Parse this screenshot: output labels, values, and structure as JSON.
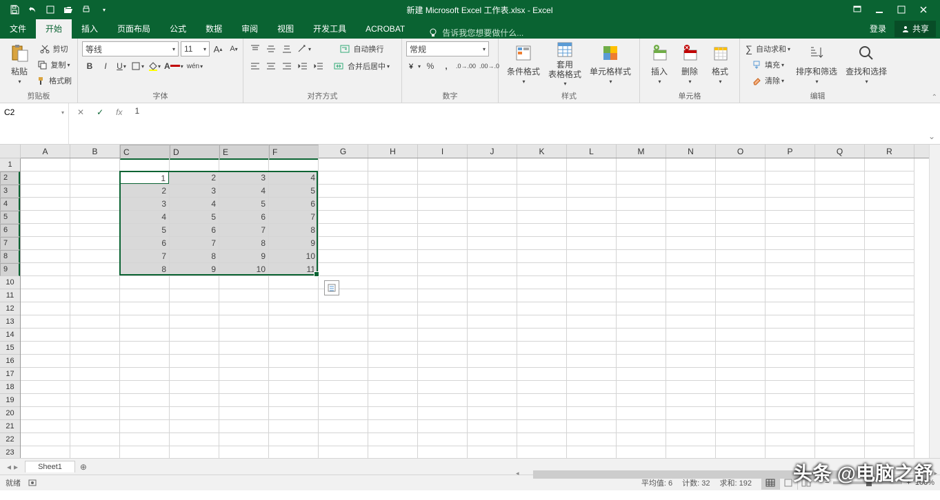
{
  "title": "新建 Microsoft Excel 工作表.xlsx - Excel",
  "tabs": {
    "file": "文件",
    "list": [
      "开始",
      "插入",
      "页面布局",
      "公式",
      "数据",
      "审阅",
      "视图",
      "开发工具",
      "ACROBAT"
    ],
    "active": 0,
    "tellme_placeholder": "告诉我您想要做什么...",
    "login": "登录",
    "share": "共享"
  },
  "ribbon": {
    "clipboard": {
      "paste": "粘贴",
      "cut": "剪切",
      "copy": "复制",
      "painter": "格式刷",
      "label": "剪贴板"
    },
    "font": {
      "name": "等线",
      "size": "11",
      "label": "字体"
    },
    "align": {
      "wrap": "自动换行",
      "merge": "合并后居中",
      "label": "对齐方式"
    },
    "number": {
      "format": "常规",
      "label": "数字"
    },
    "styles": {
      "cond": "条件格式",
      "table": "套用\n表格格式",
      "cell": "单元格样式",
      "label": "样式"
    },
    "cells": {
      "insert": "插入",
      "delete": "删除",
      "format": "格式",
      "label": "单元格"
    },
    "editing": {
      "sum": "自动求和",
      "fill": "填充",
      "clear": "清除",
      "sort": "排序和筛选",
      "find": "查找和选择",
      "label": "编辑"
    }
  },
  "namebox": "C2",
  "formula": "1",
  "columns": [
    "A",
    "B",
    "C",
    "D",
    "E",
    "F",
    "G",
    "H",
    "I",
    "J",
    "K",
    "L",
    "M",
    "N",
    "O",
    "P",
    "Q",
    "R"
  ],
  "selectedCols": [
    2,
    3,
    4,
    5
  ],
  "rowCount": 23,
  "selectedRows": [
    2,
    3,
    4,
    5,
    6,
    7,
    8,
    9
  ],
  "data": {
    "r2": {
      "C": "1",
      "D": "2",
      "E": "3",
      "F": "4"
    },
    "r3": {
      "C": "2",
      "D": "3",
      "E": "4",
      "F": "5"
    },
    "r4": {
      "C": "3",
      "D": "4",
      "E": "5",
      "F": "6"
    },
    "r5": {
      "C": "4",
      "D": "5",
      "E": "6",
      "F": "7"
    },
    "r6": {
      "C": "5",
      "D": "6",
      "E": "7",
      "F": "8"
    },
    "r7": {
      "C": "6",
      "D": "7",
      "E": "8",
      "F": "9"
    },
    "r8": {
      "C": "7",
      "D": "8",
      "E": "9",
      "F": "10"
    },
    "r9": {
      "C": "8",
      "D": "9",
      "E": "10",
      "F": "11"
    }
  },
  "selection": {
    "startCol": 2,
    "endCol": 5,
    "startRow": 2,
    "endRow": 9,
    "activeCol": 2,
    "activeRow": 2
  },
  "sheet": {
    "name": "Sheet1"
  },
  "status": {
    "ready": "就绪",
    "avg_label": "平均值:",
    "avg": "6",
    "count_label": "计数:",
    "count": "32",
    "sum_label": "求和:",
    "sum": "192",
    "zoom": "100%"
  },
  "watermark": "头条 @电脑之舒"
}
